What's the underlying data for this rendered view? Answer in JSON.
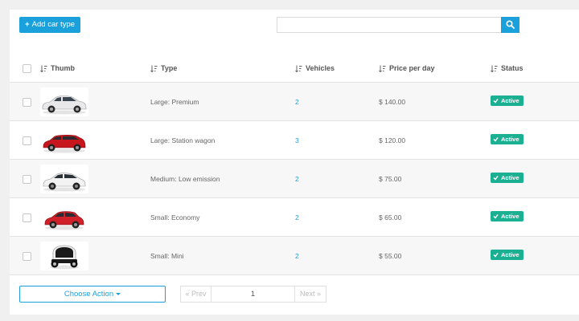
{
  "toolbar": {
    "add_label": "Add car type",
    "search_value": "",
    "search_placeholder": ""
  },
  "table": {
    "headers": {
      "thumb": "Thumb",
      "type": "Type",
      "vehicles": "Vehicles",
      "price": "Price per day",
      "status": "Status"
    },
    "rows": [
      {
        "type": "Large: Premium",
        "vehicles": "2",
        "price": "$ 140.00",
        "status": "Active",
        "car_color": "#e8e8ea"
      },
      {
        "type": "Large: Station wagon",
        "vehicles": "3",
        "price": "$ 120.00",
        "status": "Active",
        "car_color": "#c8161d"
      },
      {
        "type": "Medium: Low emission",
        "vehicles": "2",
        "price": "$ 75.00",
        "status": "Active",
        "car_color": "#f2f2f2"
      },
      {
        "type": "Small: Economy",
        "vehicles": "2",
        "price": "$ 65.00",
        "status": "Active",
        "car_color": "#d0202a"
      },
      {
        "type": "Small: Mini",
        "vehicles": "2",
        "price": "$ 55.00",
        "status": "Active",
        "car_color": "#1a1a1a"
      }
    ]
  },
  "footer": {
    "choose_action": "Choose Action",
    "prev": "« Prev",
    "page": "1",
    "next": "Next »"
  },
  "colors": {
    "accent": "#1aa1dc",
    "active_badge": "#1cb093",
    "link": "#2a9bd6"
  }
}
